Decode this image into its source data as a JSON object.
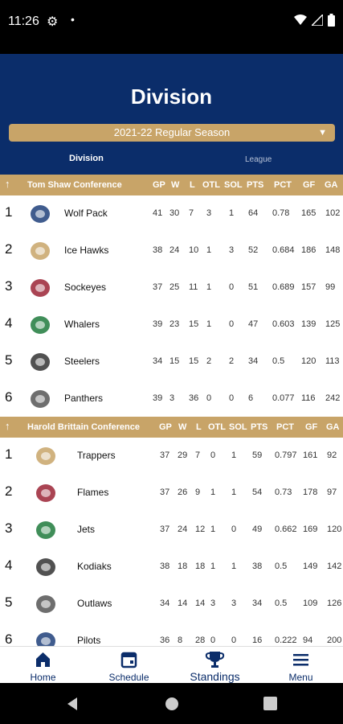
{
  "status": {
    "time": "11:26"
  },
  "header": {
    "title": "Division",
    "season": "2021-22 Regular Season",
    "tabs": [
      "Division",
      "League"
    ]
  },
  "columns": [
    "GP",
    "W",
    "L",
    "OTL",
    "SOL",
    "PTS",
    "PCT",
    "GF",
    "GA"
  ],
  "conferences": [
    {
      "name": "Tom Shaw Conference",
      "teams": [
        {
          "rank": "1",
          "name": "Wolf Pack",
          "gp": "41",
          "w": "30",
          "l": "7",
          "otl": "3",
          "sol": "1",
          "pts": "64",
          "pct": "0.78",
          "gf": "165",
          "ga": "102"
        },
        {
          "rank": "2",
          "name": "Ice Hawks",
          "gp": "38",
          "w": "24",
          "l": "10",
          "otl": "1",
          "sol": "3",
          "pts": "52",
          "pct": "0.684",
          "gf": "186",
          "ga": "148"
        },
        {
          "rank": "3",
          "name": "Sockeyes",
          "gp": "37",
          "w": "25",
          "l": "11",
          "otl": "1",
          "sol": "0",
          "pts": "51",
          "pct": "0.689",
          "gf": "157",
          "ga": "99"
        },
        {
          "rank": "4",
          "name": "Whalers",
          "gp": "39",
          "w": "23",
          "l": "15",
          "otl": "1",
          "sol": "0",
          "pts": "47",
          "pct": "0.603",
          "gf": "139",
          "ga": "125"
        },
        {
          "rank": "5",
          "name": "Steelers",
          "gp": "34",
          "w": "15",
          "l": "15",
          "otl": "2",
          "sol": "2",
          "pts": "34",
          "pct": "0.5",
          "gf": "120",
          "ga": "113"
        },
        {
          "rank": "6",
          "name": "Panthers",
          "gp": "39",
          "w": "3",
          "l": "36",
          "otl": "0",
          "sol": "0",
          "pts": "6",
          "pct": "0.077",
          "gf": "116",
          "ga": "242"
        }
      ]
    },
    {
      "name": "Harold Brittain Conference",
      "teams": [
        {
          "rank": "1",
          "name": "Trappers",
          "gp": "37",
          "w": "29",
          "l": "7",
          "otl": "0",
          "sol": "1",
          "pts": "59",
          "pct": "0.797",
          "gf": "161",
          "ga": "92"
        },
        {
          "rank": "2",
          "name": "Flames",
          "gp": "37",
          "w": "26",
          "l": "9",
          "otl": "1",
          "sol": "1",
          "pts": "54",
          "pct": "0.73",
          "gf": "178",
          "ga": "97"
        },
        {
          "rank": "3",
          "name": "Jets",
          "gp": "37",
          "w": "24",
          "l": "12",
          "otl": "1",
          "sol": "0",
          "pts": "49",
          "pct": "0.662",
          "gf": "169",
          "ga": "120"
        },
        {
          "rank": "4",
          "name": "Kodiaks",
          "gp": "38",
          "w": "18",
          "l": "18",
          "otl": "1",
          "sol": "1",
          "pts": "38",
          "pct": "0.5",
          "gf": "149",
          "ga": "142"
        },
        {
          "rank": "5",
          "name": "Outlaws",
          "gp": "34",
          "w": "14",
          "l": "14",
          "otl": "3",
          "sol": "3",
          "pts": "34",
          "pct": "0.5",
          "gf": "109",
          "ga": "126"
        },
        {
          "rank": "6",
          "name": "Pilots",
          "gp": "36",
          "w": "8",
          "l": "28",
          "otl": "0",
          "sol": "0",
          "pts": "16",
          "pct": "0.222",
          "gf": "94",
          "ga": "200"
        }
      ]
    }
  ],
  "nav": [
    {
      "label": "Home",
      "icon": "home-icon"
    },
    {
      "label": "Schedule",
      "icon": "calendar-icon"
    },
    {
      "label": "Standings",
      "icon": "trophy-icon"
    },
    {
      "label": "Menu",
      "icon": "menu-icon"
    }
  ],
  "colors": {
    "navy": "#0b2d6a",
    "gold": "#c8a468"
  }
}
